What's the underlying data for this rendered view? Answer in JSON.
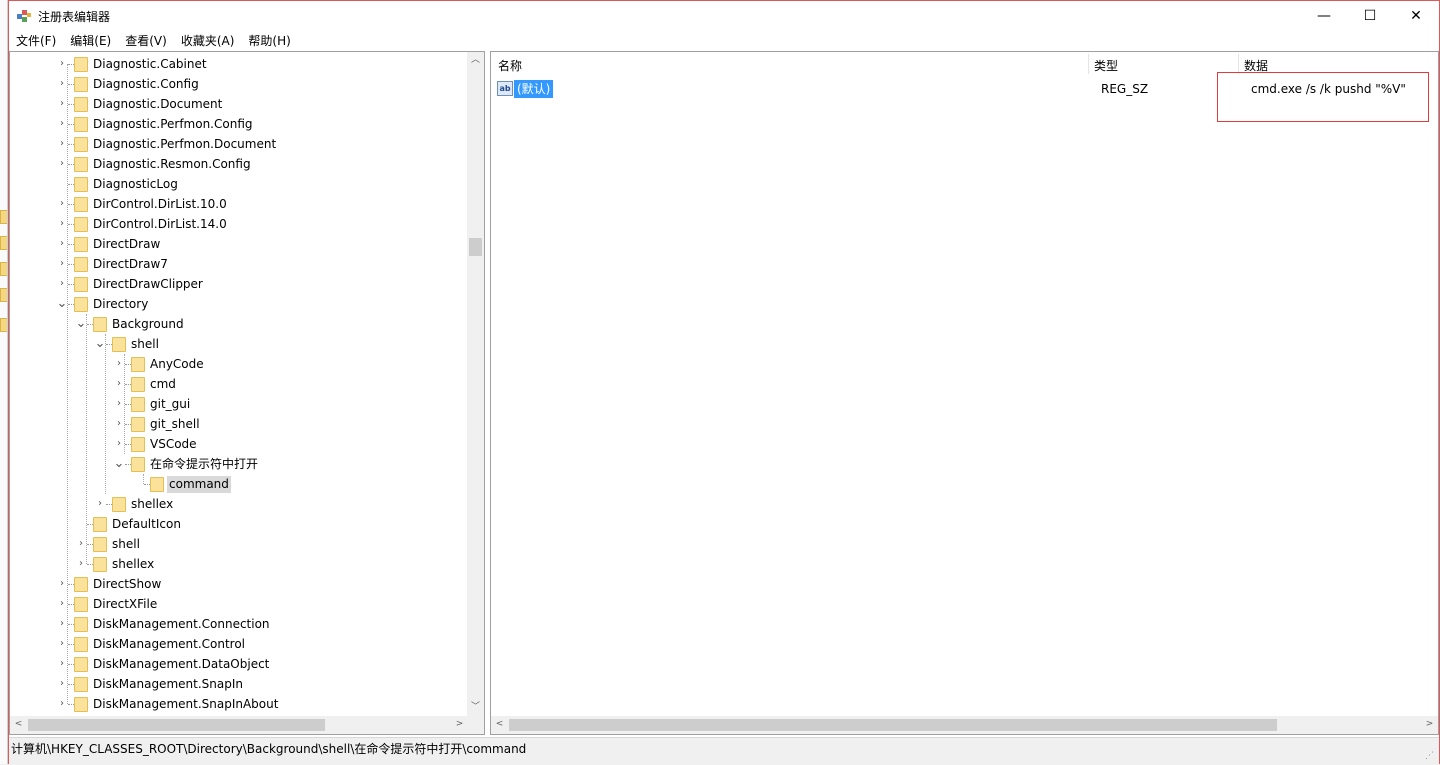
{
  "window": {
    "title": "注册表编辑器",
    "minimize": "—",
    "maximize": "☐",
    "close": "✕"
  },
  "menu": [
    "文件(F)",
    "编辑(E)",
    "查看(V)",
    "收藏夹(A)",
    "帮助(H)"
  ],
  "tree": {
    "rows": [
      {
        "label": "Diagnostic.Cabinet",
        "level": 0,
        "state": "collapsed"
      },
      {
        "label": "Diagnostic.Config",
        "level": 0,
        "state": "collapsed"
      },
      {
        "label": "Diagnostic.Document",
        "level": 0,
        "state": "collapsed"
      },
      {
        "label": "Diagnostic.Perfmon.Config",
        "level": 0,
        "state": "collapsed"
      },
      {
        "label": "Diagnostic.Perfmon.Document",
        "level": 0,
        "state": "collapsed"
      },
      {
        "label": "Diagnostic.Resmon.Config",
        "level": 0,
        "state": "collapsed"
      },
      {
        "label": "DiagnosticLog",
        "level": 0,
        "state": "leaf"
      },
      {
        "label": "DirControl.DirList.10.0",
        "level": 0,
        "state": "collapsed"
      },
      {
        "label": "DirControl.DirList.14.0",
        "level": 0,
        "state": "collapsed"
      },
      {
        "label": "DirectDraw",
        "level": 0,
        "state": "collapsed"
      },
      {
        "label": "DirectDraw7",
        "level": 0,
        "state": "collapsed"
      },
      {
        "label": "DirectDrawClipper",
        "level": 0,
        "state": "collapsed"
      },
      {
        "label": "Directory",
        "level": 0,
        "state": "expanded"
      },
      {
        "label": "Background",
        "level": 1,
        "state": "expanded"
      },
      {
        "label": "shell",
        "level": 2,
        "state": "expanded"
      },
      {
        "label": "AnyCode",
        "level": 3,
        "state": "collapsed"
      },
      {
        "label": "cmd",
        "level": 3,
        "state": "collapsed"
      },
      {
        "label": "git_gui",
        "level": 3,
        "state": "collapsed"
      },
      {
        "label": "git_shell",
        "level": 3,
        "state": "collapsed"
      },
      {
        "label": "VSCode",
        "level": 3,
        "state": "collapsed"
      },
      {
        "label": "在命令提示符中打开",
        "level": 3,
        "state": "expanded"
      },
      {
        "label": "command",
        "level": 4,
        "state": "leaf",
        "selected": true
      },
      {
        "label": "shellex",
        "level": 2,
        "state": "collapsed"
      },
      {
        "label": "DefaultIcon",
        "level": 1,
        "state": "leaf"
      },
      {
        "label": "shell",
        "level": 1,
        "state": "collapsed"
      },
      {
        "label": "shellex",
        "level": 1,
        "state": "collapsed"
      },
      {
        "label": "DirectShow",
        "level": 0,
        "state": "collapsed"
      },
      {
        "label": "DirectXFile",
        "level": 0,
        "state": "collapsed"
      },
      {
        "label": "DiskManagement.Connection",
        "level": 0,
        "state": "collapsed"
      },
      {
        "label": "DiskManagement.Control",
        "level": 0,
        "state": "collapsed"
      },
      {
        "label": "DiskManagement.DataObject",
        "level": 0,
        "state": "collapsed"
      },
      {
        "label": "DiskManagement.SnapIn",
        "level": 0,
        "state": "collapsed"
      },
      {
        "label": "DiskManagement.SnapInAbout",
        "level": 0,
        "state": "collapsed"
      }
    ]
  },
  "list": {
    "columns": {
      "name": "名称",
      "type": "类型",
      "data": "数据"
    },
    "rows": [
      {
        "icon": "ab",
        "name": "(默认)",
        "type": "REG_SZ",
        "data": "cmd.exe /s /k pushd \"%V\""
      }
    ]
  },
  "status": {
    "path": "计算机\\HKEY_CLASSES_ROOT\\Directory\\Background\\shell\\在命令提示符中打开\\command"
  },
  "scroll": {
    "up": "︿",
    "down": "﹀",
    "left": "<",
    "right": ">"
  },
  "colors": {
    "selection": "#3399ff",
    "folder": "#fbe29a",
    "highlight_box": "#e23b3b"
  }
}
